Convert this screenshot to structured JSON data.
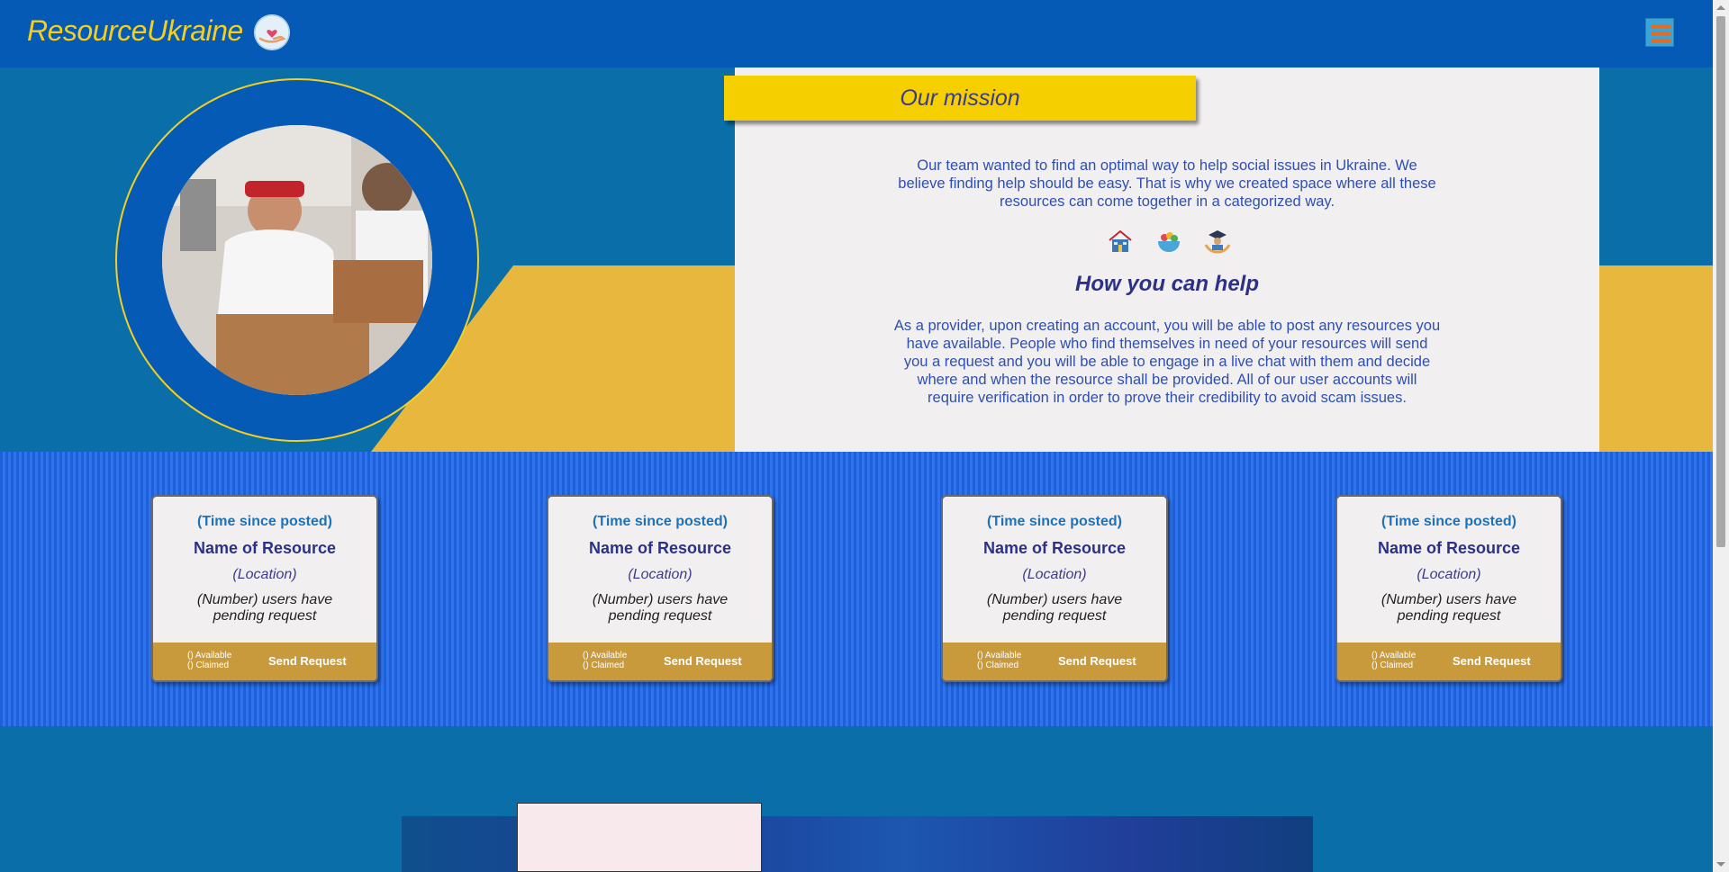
{
  "navbar": {
    "logo_text": "ResourceUkraine",
    "logo_icon": "heart-hand-icon",
    "menu_icon": "hamburger-menu-icon"
  },
  "hero": {
    "mission_title": "Our mission",
    "mission_text": "Our team wanted to find an optimal way to help social issues in Ukraine. We believe finding help should be easy. That is why we created space where all these resources can come together in a categorized way.",
    "help_icons": [
      "shelter-icon",
      "food-bowl-icon",
      "education-icon"
    ],
    "help_title": "How you can help",
    "help_text": "As a provider, upon creating an account, you will be able to post any resources you have available. People who find themselves in need of your resources will send you a request and you will be able to engage in a live chat with them and decide where and when the resource shall be provided. All of our user accounts will require verification in order to prove their credibility to avoid scam issues."
  },
  "cards": [
    {
      "time": "(Time since posted)",
      "name": "Name of Resource",
      "location": "(Location)",
      "users": "(Number) users have pending request",
      "available": "() Available",
      "claimed": "() Claimed",
      "send_label": "Send Request"
    },
    {
      "time": "(Time since posted)",
      "name": "Name of Resource",
      "location": "(Location)",
      "users": "(Number) users have pending request",
      "available": "() Available",
      "claimed": "() Claimed",
      "send_label": "Send Request"
    },
    {
      "time": "(Time since posted)",
      "name": "Name of Resource",
      "location": "(Location)",
      "users": "(Number) users have pending request",
      "available": "() Available",
      "claimed": "() Claimed",
      "send_label": "Send Request"
    },
    {
      "time": "(Time since posted)",
      "name": "Name of Resource",
      "location": "(Location)",
      "users": "(Number) users have pending request",
      "available": "() Available",
      "claimed": "() Claimed",
      "send_label": "Send Request"
    }
  ],
  "colors": {
    "nav_blue": "#055ab6",
    "page_blue": "#0a6fa8",
    "accent_yellow": "#f6cf00",
    "card_footer": "#c99a3c"
  }
}
